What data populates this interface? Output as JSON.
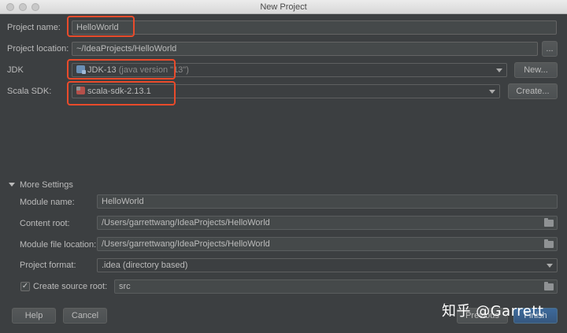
{
  "window": {
    "title": "New Project"
  },
  "project_name": {
    "label": "Project name:",
    "value": "HelloWorld"
  },
  "project_location": {
    "label": "Project location:",
    "value": "~/IdeaProjects/HelloWorld",
    "browse_label": "..."
  },
  "jdk": {
    "label": "JDK",
    "value": "JDK-13",
    "detail": "(java version \"13\")",
    "new_label": "New..."
  },
  "scala_sdk": {
    "label": "Scala SDK:",
    "value": "scala-sdk-2.13.1",
    "create_label": "Create..."
  },
  "more_settings": {
    "title": "More Settings",
    "module_name": {
      "label": "Module name:",
      "value": "HelloWorld"
    },
    "content_root": {
      "label": "Content root:",
      "value": "/Users/garrettwang/IdeaProjects/HelloWorld"
    },
    "module_file_location": {
      "label": "Module file location:",
      "value": "/Users/garrettwang/IdeaProjects/HelloWorld"
    },
    "project_format": {
      "label": "Project format:",
      "value": ".idea (directory based)"
    },
    "create_source_root": {
      "label": "Create source root:",
      "checked": true,
      "value": "src"
    }
  },
  "buttons": {
    "help": "Help",
    "cancel": "Cancel",
    "previous": "Previous",
    "finish": "Finish"
  },
  "watermark": "知乎 @Garrett",
  "colors": {
    "highlight": "#e94b2b",
    "background": "#3c3f41",
    "finish": "#365880"
  }
}
